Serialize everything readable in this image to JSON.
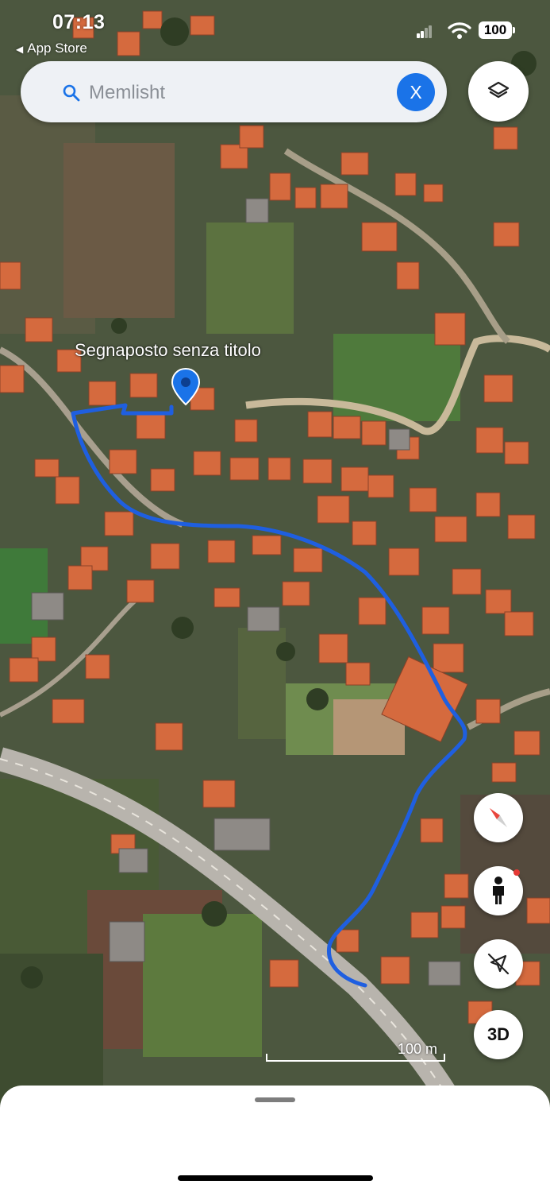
{
  "status_bar": {
    "time": "07:13",
    "back_app": "App Store",
    "battery": "100"
  },
  "search": {
    "query": "",
    "placeholder": "Memlisht",
    "clear_label": "X"
  },
  "map": {
    "placemark_label": "Segnaposto senza titolo",
    "scale_label": "100 m",
    "view_mode_label": "3D",
    "colors": {
      "route": "#1f5fe0",
      "pin": "#1a73e8",
      "roof": "#d9683e",
      "field": "#4d6a3a"
    }
  },
  "icons": [
    "search-icon",
    "layers-icon",
    "compass-icon",
    "pegman-icon",
    "location-disabled-icon",
    "map-pin-icon"
  ]
}
